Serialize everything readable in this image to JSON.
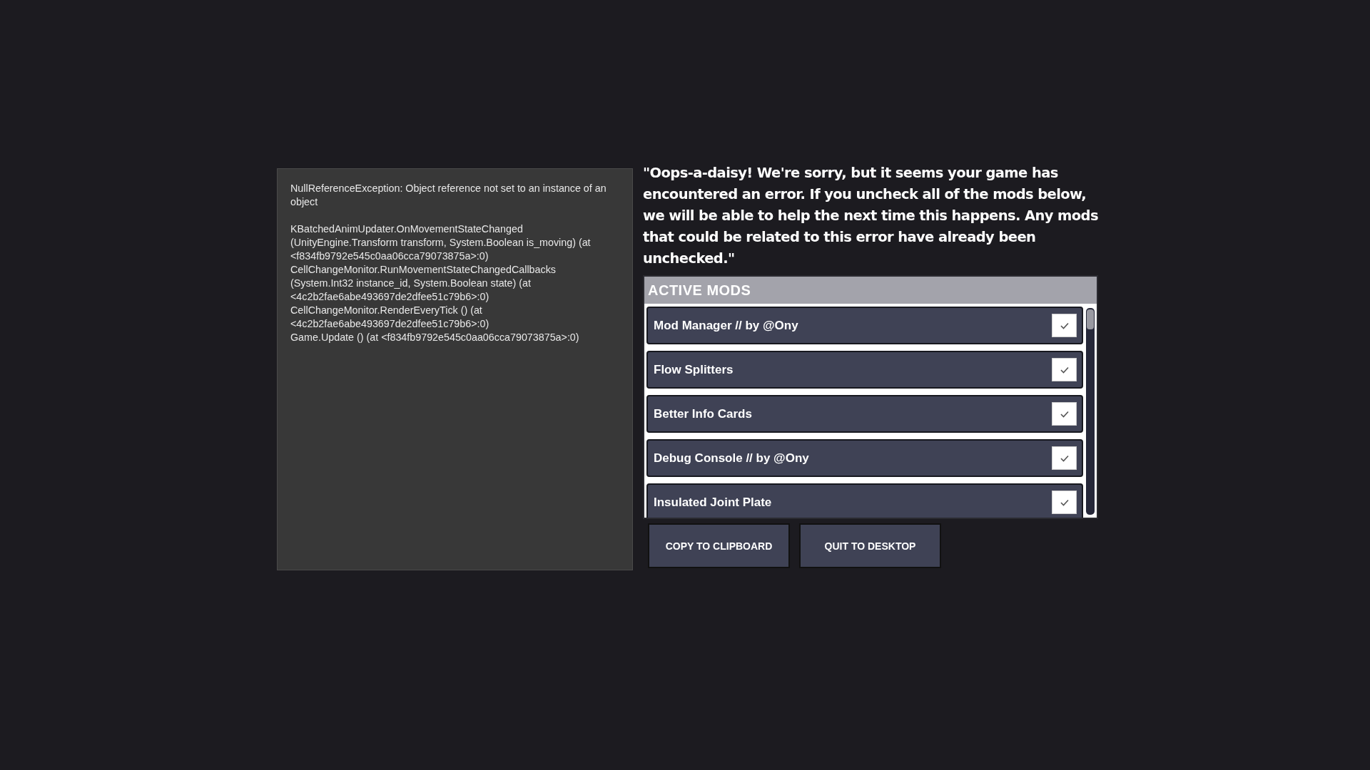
{
  "error_log": {
    "exception": "NullReferenceException: Object reference not set to an instance of an object",
    "stack_trace": [
      "KBatchedAnimUpdater.OnMovementStateChanged (UnityEngine.Transform transform, System.Boolean is_moving) (at <f834fb9792e545c0aa06cca79073875a>:0)",
      "CellChangeMonitor.RunMovementStateChangedCallbacks (System.Int32 instance_id, System.Boolean state) (at <4c2b2fae6abe493697de2dfee51c79b6>:0)",
      "CellChangeMonitor.RenderEveryTick () (at <4c2b2fae6abe493697de2dfee51c79b6>:0)",
      "Game.Update () (at <f834fb9792e545c0aa06cca79073875a>:0)"
    ]
  },
  "message": "\"Oops-a-daisy! We're sorry, but it seems your game has encountered an error. If you uncheck all of the mods below, we will be able to help the next time this happens. Any mods that could be related to this error have already been unchecked.\"",
  "mods_panel": {
    "title": "ACTIVE MODS",
    "mods": [
      {
        "name": "Mod Manager // by @Ony",
        "checked": true
      },
      {
        "name": "Flow Splitters",
        "checked": true
      },
      {
        "name": "Better Info Cards",
        "checked": true
      },
      {
        "name": "Debug Console // by @Ony",
        "checked": true
      },
      {
        "name": "Insulated Joint Plate",
        "checked": true
      }
    ]
  },
  "buttons": [
    "COPY TO CLIPBOARD",
    "QUIT TO DESKTOP"
  ]
}
